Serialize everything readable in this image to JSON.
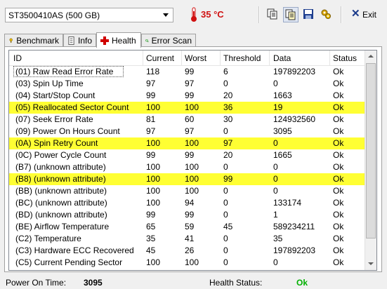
{
  "toolbar": {
    "drive": "ST3500410AS (500 GB)",
    "temperature": "35 °C",
    "exit_label": "Exit",
    "icons": [
      "copy-icon",
      "copy-all-icon",
      "save-icon",
      "settings-icon",
      "exit-icon"
    ]
  },
  "tabs": [
    {
      "label": "Benchmark",
      "icon": "benchmark-icon",
      "active": false
    },
    {
      "label": "Info",
      "icon": "info-icon",
      "active": false
    },
    {
      "label": "Health",
      "icon": "health-icon",
      "active": true
    },
    {
      "label": "Error Scan",
      "icon": "error-scan-icon",
      "active": false
    }
  ],
  "table": {
    "columns": [
      "ID",
      "Current",
      "Worst",
      "Threshold",
      "Data",
      "Status"
    ],
    "rows": [
      {
        "id": "(01) Raw Read Error Rate",
        "current": "118",
        "worst": "99",
        "threshold": "6",
        "data": "197892203",
        "status": "Ok",
        "warn": false
      },
      {
        "id": "(03) Spin Up Time",
        "current": "97",
        "worst": "97",
        "threshold": "0",
        "data": "0",
        "status": "Ok",
        "warn": false
      },
      {
        "id": "(04) Start/Stop Count",
        "current": "99",
        "worst": "99",
        "threshold": "20",
        "data": "1663",
        "status": "Ok",
        "warn": false
      },
      {
        "id": "(05) Reallocated Sector Count",
        "current": "100",
        "worst": "100",
        "threshold": "36",
        "data": "19",
        "status": "Ok",
        "warn": true
      },
      {
        "id": "(07) Seek Error Rate",
        "current": "81",
        "worst": "60",
        "threshold": "30",
        "data": "124932560",
        "status": "Ok",
        "warn": false
      },
      {
        "id": "(09) Power On Hours Count",
        "current": "97",
        "worst": "97",
        "threshold": "0",
        "data": "3095",
        "status": "Ok",
        "warn": false
      },
      {
        "id": "(0A) Spin Retry Count",
        "current": "100",
        "worst": "100",
        "threshold": "97",
        "data": "0",
        "status": "Ok",
        "warn": true
      },
      {
        "id": "(0C) Power Cycle Count",
        "current": "99",
        "worst": "99",
        "threshold": "20",
        "data": "1665",
        "status": "Ok",
        "warn": false
      },
      {
        "id": "(B7) (unknown attribute)",
        "current": "100",
        "worst": "100",
        "threshold": "0",
        "data": "0",
        "status": "Ok",
        "warn": false
      },
      {
        "id": "(B8) (unknown attribute)",
        "current": "100",
        "worst": "100",
        "threshold": "99",
        "data": "0",
        "status": "Ok",
        "warn": true
      },
      {
        "id": "(BB) (unknown attribute)",
        "current": "100",
        "worst": "100",
        "threshold": "0",
        "data": "0",
        "status": "Ok",
        "warn": false
      },
      {
        "id": "(BC) (unknown attribute)",
        "current": "100",
        "worst": "94",
        "threshold": "0",
        "data": "133174",
        "status": "Ok",
        "warn": false
      },
      {
        "id": "(BD) (unknown attribute)",
        "current": "99",
        "worst": "99",
        "threshold": "0",
        "data": "1",
        "status": "Ok",
        "warn": false
      },
      {
        "id": "(BE) Airflow Temperature",
        "current": "65",
        "worst": "59",
        "threshold": "45",
        "data": "589234211",
        "status": "Ok",
        "warn": false
      },
      {
        "id": "(C2) Temperature",
        "current": "35",
        "worst": "41",
        "threshold": "0",
        "data": "35",
        "status": "Ok",
        "warn": false
      },
      {
        "id": "(C3) Hardware ECC Recovered",
        "current": "45",
        "worst": "26",
        "threshold": "0",
        "data": "197892203",
        "status": "Ok",
        "warn": false
      },
      {
        "id": "(C5) Current Pending Sector",
        "current": "100",
        "worst": "100",
        "threshold": "0",
        "data": "0",
        "status": "Ok",
        "warn": false
      }
    ]
  },
  "status_bar": {
    "power_on_label": "Power On Time:",
    "power_on_value": "3095",
    "health_label": "Health Status:",
    "health_value": "Ok"
  },
  "colors": {
    "warn_row": "#ffff33",
    "health_ok": "#00b000",
    "temp_red": "#d01010"
  }
}
